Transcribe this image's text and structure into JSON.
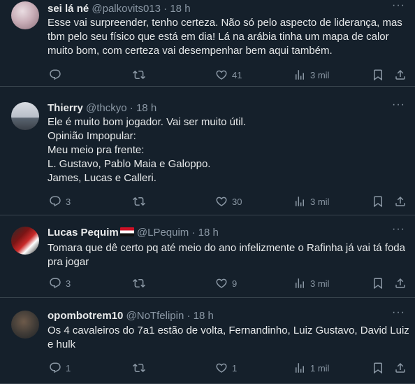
{
  "tweets": [
    {
      "name": "sei lá né",
      "handle": "@palkovits013",
      "time": "18 h",
      "flag": false,
      "body": [
        "Esse vai surpreender, tenho certeza. Não só pelo aspecto de liderança, mas",
        "tbm pelo seu físico que está em dia! Lá na arábia tinha um mapa de calor",
        "muito bom, com certeza vai desempenhar bem aqui também."
      ],
      "replies": "",
      "retweets": "",
      "likes": "41",
      "views": "3 mil"
    },
    {
      "name": "Thierry",
      "handle": "@thckyo",
      "time": "18 h",
      "flag": false,
      "body": [
        "Ele é muito bom jogador. Vai ser muito útil.",
        "Opinião Impopular:",
        "Meu meio pra frente:",
        "L. Gustavo, Pablo Maia e Galoppo.",
        "James, Lucas e Calleri."
      ],
      "replies": "3",
      "retweets": "",
      "likes": "30",
      "views": "3 mil"
    },
    {
      "name": "Lucas Pequim",
      "handle": "@LPequim",
      "time": "18 h",
      "flag": true,
      "body": [
        "Tomara que dê certo pq até meio do ano infelizmente o Rafinha já vai tá foda",
        "pra jogar"
      ],
      "replies": "3",
      "retweets": "",
      "likes": "9",
      "views": "3 mil"
    },
    {
      "name": "opombotrem10",
      "handle": "@NoTfelipin",
      "time": "18 h",
      "flag": false,
      "body": [
        "Os 4 cavaleiros do 7a1 estão de volta, Fernandinho, Luiz Gustavo, David Luiz",
        "e hulk"
      ],
      "replies": "1",
      "retweets": "",
      "likes": "1",
      "views": "1 mil"
    }
  ],
  "separator": "·",
  "more_label": "···",
  "icons": {
    "reply": "reply-icon",
    "retweet": "retweet-icon",
    "like": "like-icon",
    "views": "views-icon",
    "bookmark": "bookmark-icon",
    "share": "share-icon"
  },
  "colors": {
    "background": "#15202b",
    "text": "#e7e9ea",
    "muted": "#8b98a5",
    "divider": "#38444d"
  }
}
